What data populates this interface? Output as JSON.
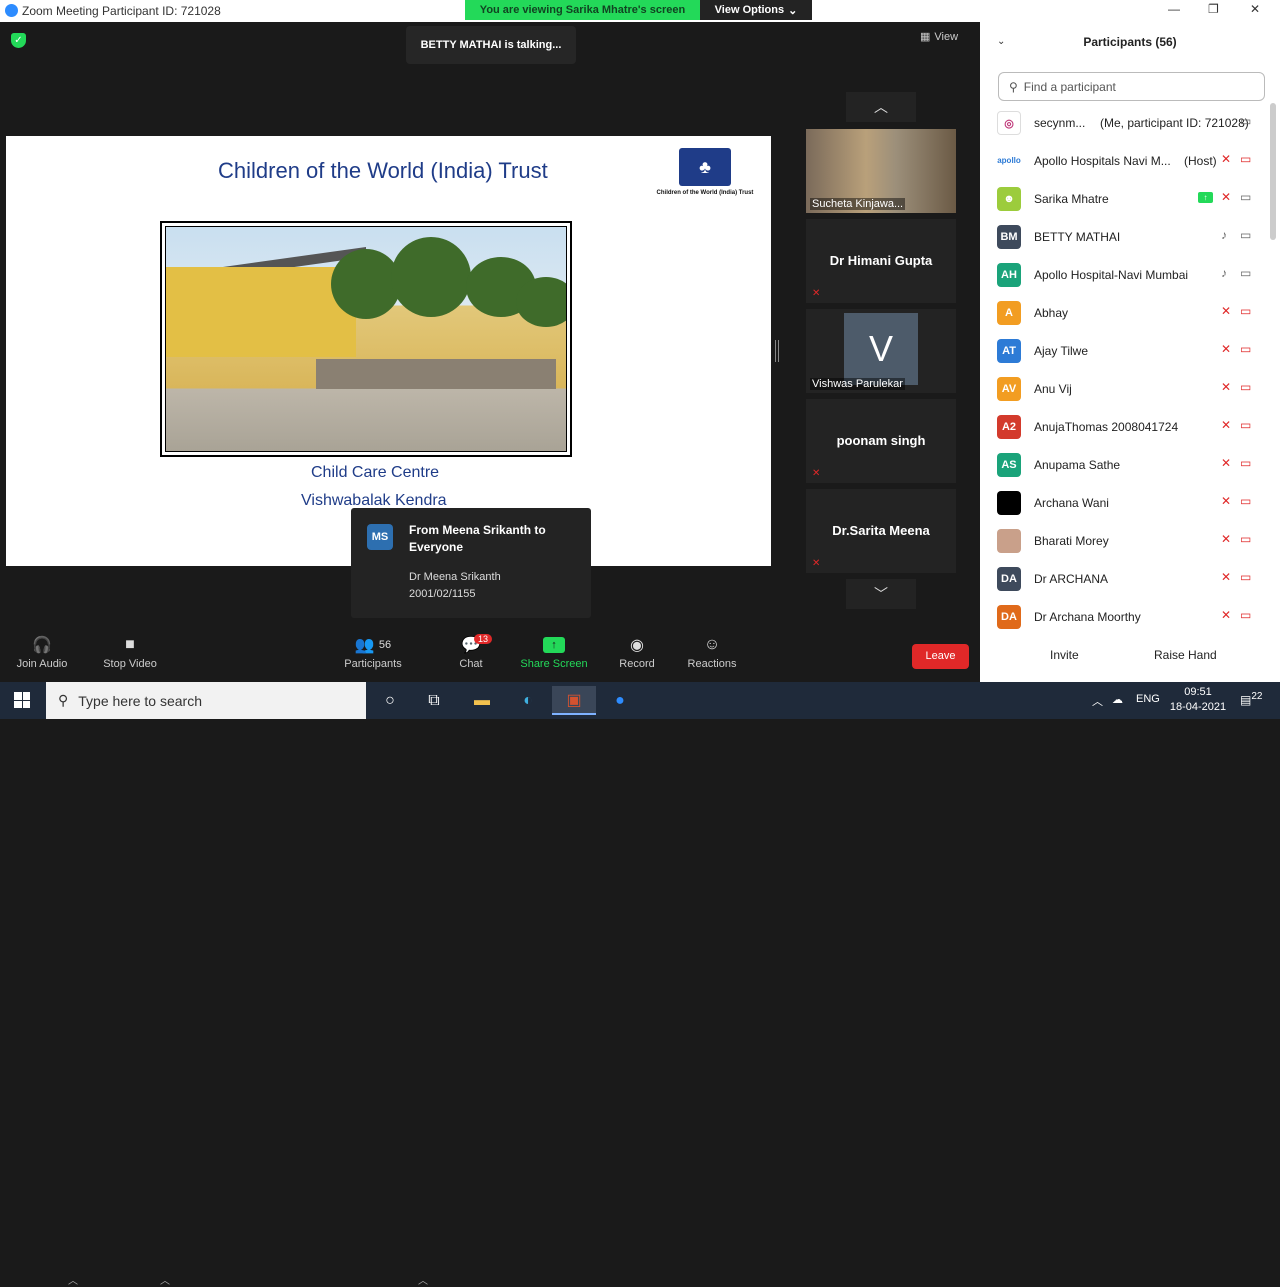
{
  "window": {
    "title": "Zoom Meeting Participant ID: 721028"
  },
  "banner": {
    "viewing": "You are viewing Sarika Mhatre's screen",
    "options": "View Options"
  },
  "talking": "BETTY MATHAI is talking...",
  "view_label": "View",
  "slide": {
    "title": "Children of the World (India) Trust",
    "logo_text": "Children of the World (India) Trust",
    "caption1": "Child Care Centre",
    "caption2": "Vishwabalak Kendra"
  },
  "gallery": [
    {
      "label": "Sucheta Kinjawa..."
    },
    {
      "name": "Dr Himani Gupta"
    },
    {
      "label": "Vishwas Parulekar",
      "initial": "V"
    },
    {
      "name": "poonam singh"
    },
    {
      "name": "Dr.Sarita Meena"
    }
  ],
  "chat_toast": {
    "avatar": "MS",
    "header": "From Meena Srikanth to Everyone",
    "line1": "Dr Meena Srikanth",
    "line2": "2001/02/1155"
  },
  "toolbar": {
    "join_audio": "Join Audio",
    "stop_video": "Stop Video",
    "participants": "Participants",
    "participants_count": "56",
    "chat": "Chat",
    "chat_badge": "13",
    "share_screen": "Share Screen",
    "record": "Record",
    "reactions": "Reactions",
    "leave": "Leave"
  },
  "panel": {
    "title": "Participants (56)",
    "search_placeholder": "Find a participant",
    "invite": "Invite",
    "raise_hand": "Raise Hand",
    "participants": [
      {
        "initials": "",
        "name": "secynm...",
        "tag": "(Me, participant ID: 721028)",
        "color": "#ffffff"
      },
      {
        "initials": "",
        "name": "Apollo Hospitals Navi M...",
        "tag": "(Host)",
        "color": "#ffffff"
      },
      {
        "initials": "",
        "name": "Sarika Mhatre",
        "color": "#9ccc3c"
      },
      {
        "initials": "BM",
        "name": "BETTY MATHAI",
        "color": "#3e4a5c"
      },
      {
        "initials": "AH",
        "name": "Apollo Hospital-Navi Mumbai",
        "color": "#1aa37a"
      },
      {
        "initials": "A",
        "name": "Abhay",
        "color": "#f29d22"
      },
      {
        "initials": "AT",
        "name": "Ajay Tilwe",
        "color": "#2d7bd6"
      },
      {
        "initials": "AV",
        "name": "Anu Vij",
        "color": "#f29d22"
      },
      {
        "initials": "A2",
        "name": "AnujaThomas 2008041724",
        "color": "#d33a2c"
      },
      {
        "initials": "AS",
        "name": "Anupama Sathe",
        "color": "#1aa37a"
      },
      {
        "initials": "",
        "name": "Archana Wani",
        "color": "#000000"
      },
      {
        "initials": "",
        "name": "Bharati Morey",
        "color": "#c9a08a"
      },
      {
        "initials": "DA",
        "name": "Dr ARCHANA",
        "color": "#3e4a5c"
      },
      {
        "initials": "DA",
        "name": "Dr Archana Moorthy",
        "color": "#e06a1a"
      }
    ]
  },
  "taskbar": {
    "search_placeholder": "Type here to search",
    "lang": "ENG",
    "time": "09:51",
    "date": "18-04-2021",
    "notifications": "22"
  }
}
